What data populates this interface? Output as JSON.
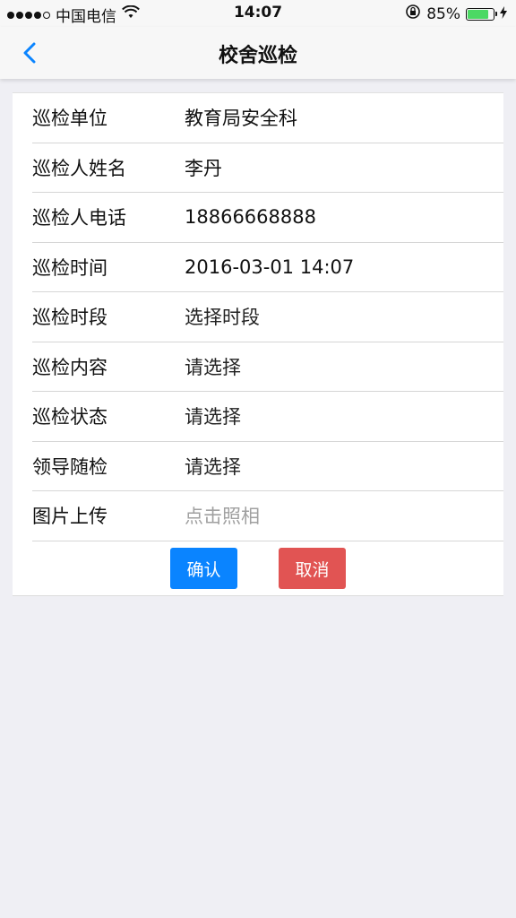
{
  "status_bar": {
    "carrier": "中国电信",
    "time": "14:07",
    "battery_percent_text": "85%",
    "battery_level": 0.85
  },
  "nav": {
    "title": "校舍巡检"
  },
  "form": {
    "rows": [
      {
        "label": "巡检单位",
        "value": "教育局安全科"
      },
      {
        "label": "巡检人姓名",
        "value": "李丹"
      },
      {
        "label": "巡检人电话",
        "value": "18866668888"
      },
      {
        "label": "巡检时间",
        "value": "2016-03-01 14:07"
      },
      {
        "label": "巡检时段",
        "value": "选择时段"
      },
      {
        "label": "巡检内容",
        "value": "请选择"
      },
      {
        "label": "巡检状态",
        "value": "请选择"
      },
      {
        "label": "领导随检",
        "value": "请选择"
      },
      {
        "label": "图片上传",
        "value": "点击照相"
      }
    ]
  },
  "buttons": {
    "confirm_label": "确认",
    "cancel_label": "取消"
  },
  "colors": {
    "accent": "#0a84ff",
    "danger": "#e15453",
    "battery": "#4cd964",
    "background": "#efeff4"
  },
  "icons": {
    "back": "chevron-left-icon",
    "wifi": "wifi-icon",
    "rotation_lock": "rotation-lock-icon",
    "charging": "charging-bolt-icon"
  }
}
